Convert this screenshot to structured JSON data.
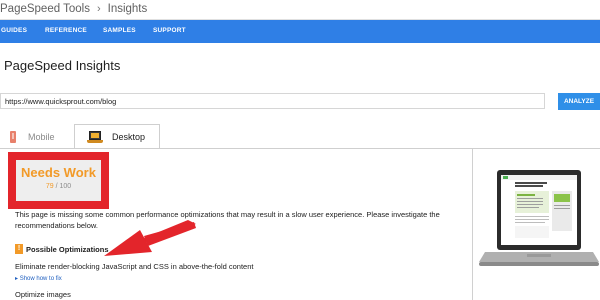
{
  "breadcrumb": {
    "root": "PageSpeed Tools",
    "separator": "›",
    "current": "Insights"
  },
  "nav": {
    "items": [
      {
        "label": "GUIDES"
      },
      {
        "label": "REFERENCE"
      },
      {
        "label": "SAMPLES"
      },
      {
        "label": "SUPPORT"
      }
    ]
  },
  "page": {
    "title": "PageSpeed Insights"
  },
  "search": {
    "url_value": "https://www.quicksprout.com/blog",
    "analyze_label": "ANALYZE"
  },
  "tabs": [
    {
      "label": "Mobile",
      "icon": "phone-icon",
      "selected": false
    },
    {
      "label": "Desktop",
      "icon": "desktop-icon",
      "selected": true
    }
  ],
  "score": {
    "verdict": "Needs Work",
    "value": "79",
    "out_of": "/ 100"
  },
  "summary": "This page is missing some common performance optimizations that may result in a slow user experience. Please investigate the recommendations below.",
  "optimizations": {
    "icon": "warning-icon",
    "icon_glyph": "!",
    "heading": "Possible Optimizations",
    "items": [
      {
        "title": "Eliminate render-blocking JavaScript and CSS in above-the-fold content",
        "link": "Show how to fix"
      },
      {
        "title": "Optimize images"
      }
    ]
  },
  "colors": {
    "nav_blue": "#2f7fe6",
    "score_orange": "#f29a28",
    "highlight_red": "#e3252b",
    "link_blue": "#2060c0"
  }
}
